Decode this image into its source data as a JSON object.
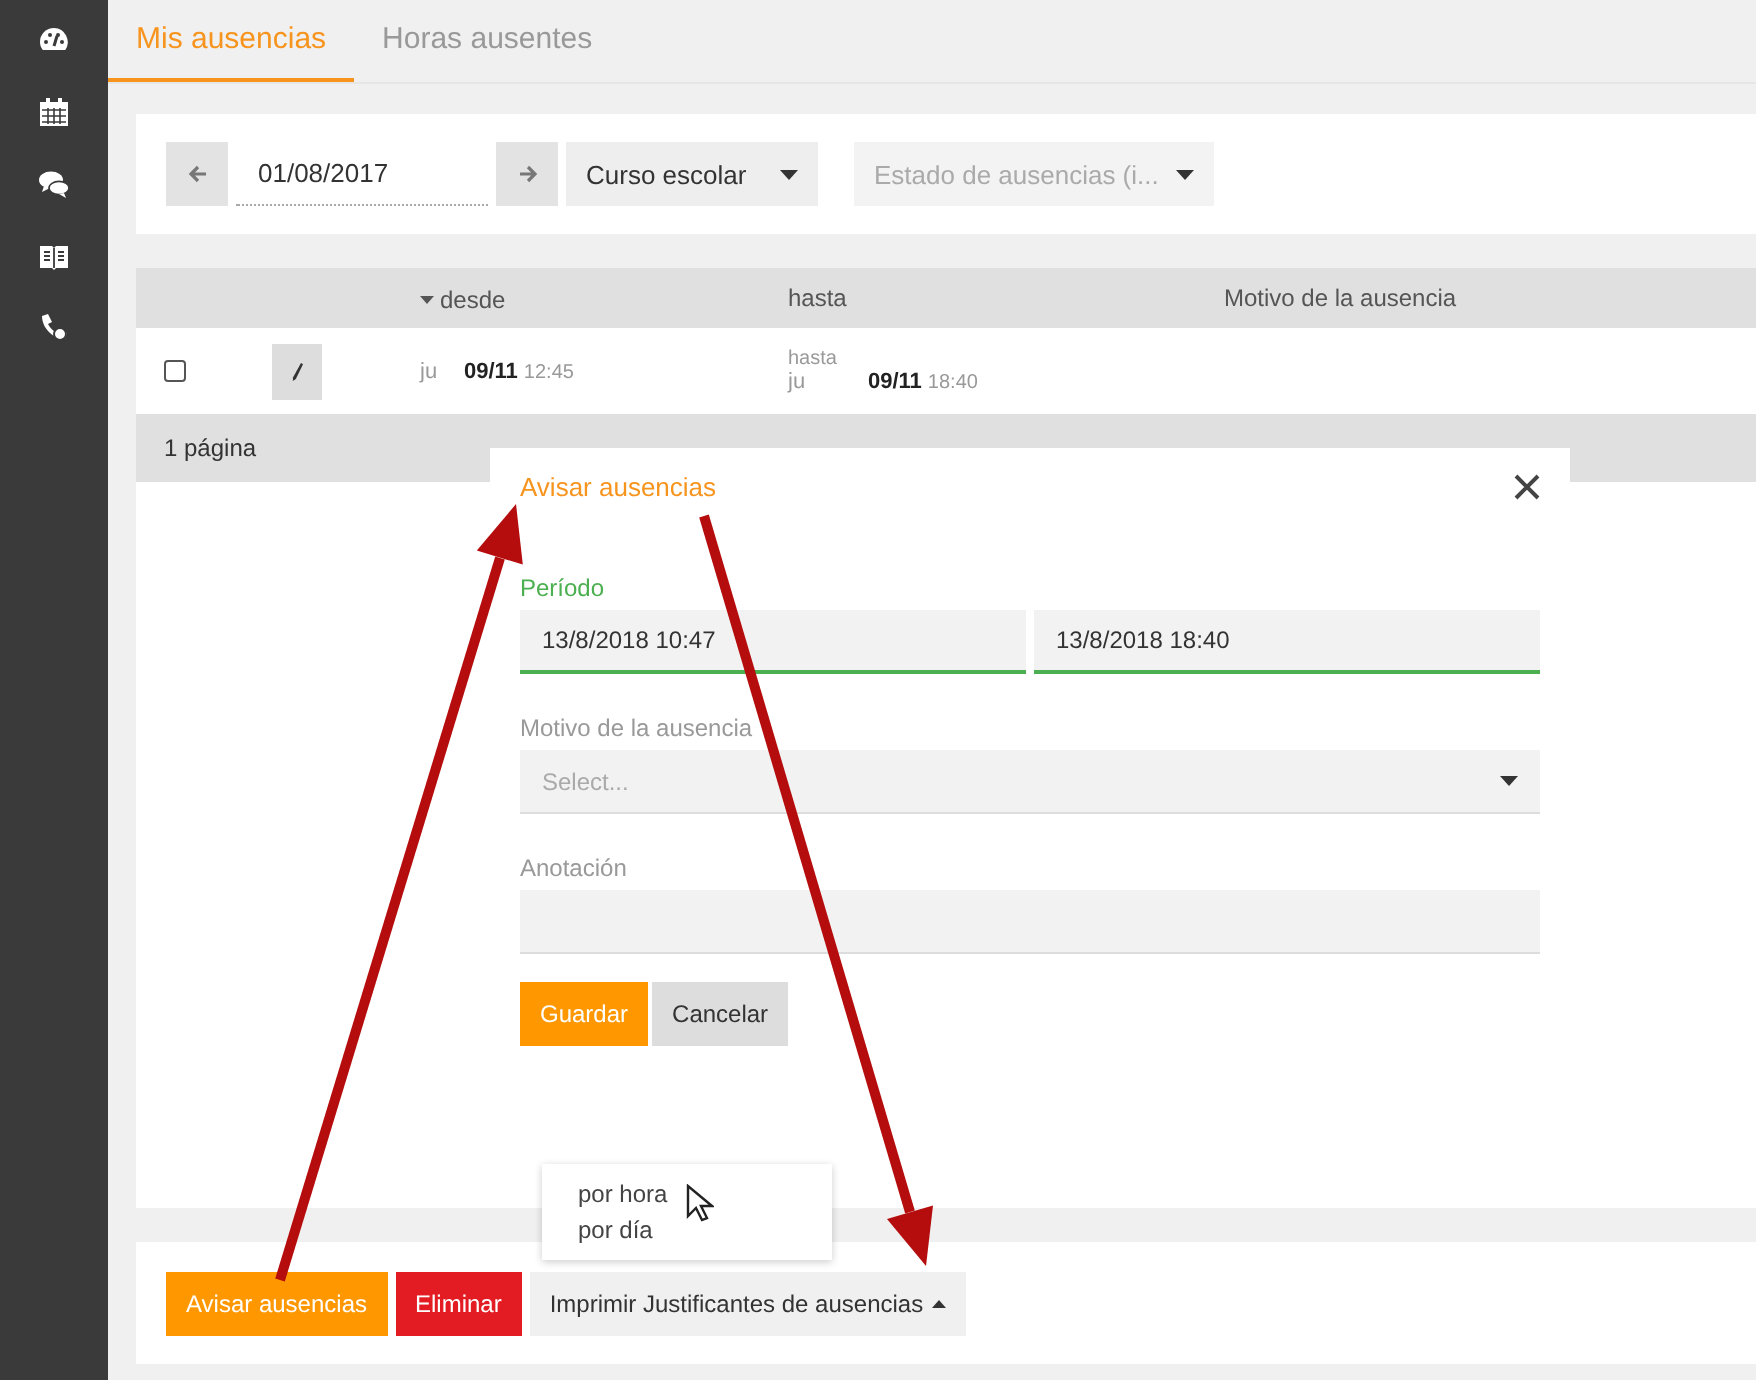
{
  "tabs": [
    {
      "label": "Mis ausencias",
      "selected": true
    },
    {
      "label": "Horas ausentes",
      "selected": false
    }
  ],
  "filters": {
    "date": "01/08/2017",
    "period_select": "Curso escolar",
    "status_select_placeholder": "Estado de ausencias (i..."
  },
  "table": {
    "columns": [
      {
        "label": "desde",
        "sorted": true
      },
      {
        "label": "hasta",
        "sorted": false
      },
      {
        "label": "Motivo de la ausencia",
        "sorted": false
      }
    ],
    "rows": [
      {
        "checked": false,
        "from": {
          "day": "ju",
          "date": "09/11",
          "time": "12:45"
        },
        "to": {
          "label": "hasta",
          "day": "ju",
          "date": "09/11",
          "time": "18:40"
        }
      }
    ],
    "pager": "1 página"
  },
  "dialog": {
    "title": "Avisar ausencias",
    "period_label": "Período",
    "period_start": "13/8/2018 10:47",
    "period_end": "13/8/2018 18:40",
    "reason_label": "Motivo de la ausencia",
    "reason_placeholder": "Select...",
    "note_label": "Anotación",
    "buttons": [
      {
        "label": "Guardar",
        "kind": "primary"
      },
      {
        "label": "Cancelar",
        "kind": "secondary"
      }
    ]
  },
  "actions": [
    {
      "label": "Avisar ausencias",
      "kind": "primary"
    },
    {
      "label": "Eliminar",
      "kind": "danger"
    },
    {
      "label": "Imprimir Justificantes de ausencias",
      "kind": "dropdown",
      "expanded": true,
      "menu": [
        "por hora",
        "por día"
      ]
    }
  ]
}
